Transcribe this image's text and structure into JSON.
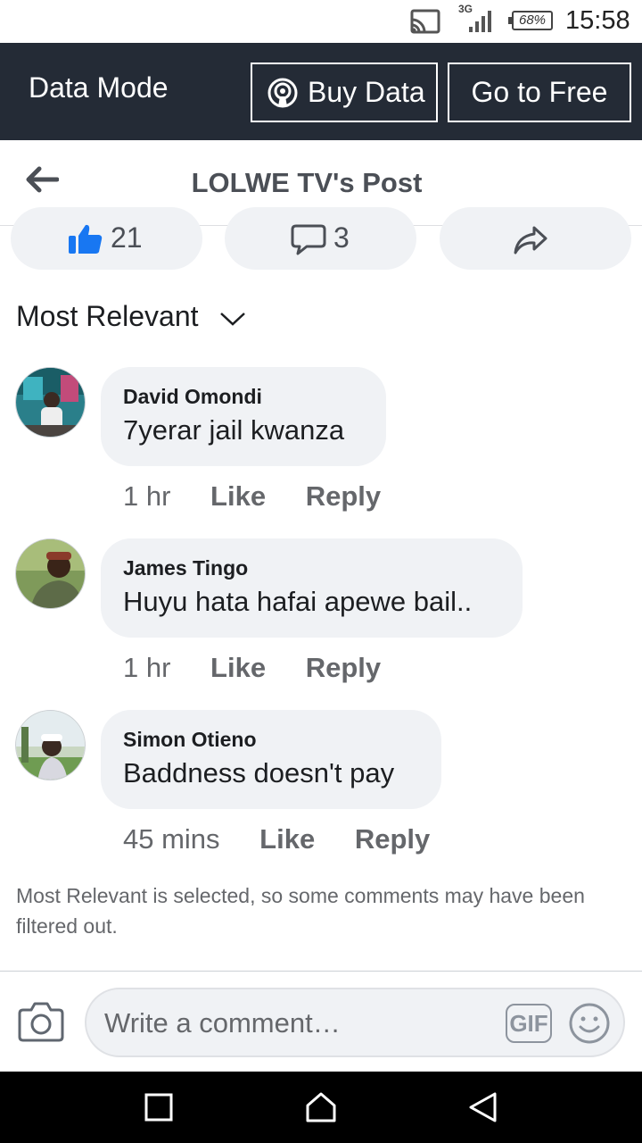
{
  "status_bar": {
    "network": "3G",
    "battery": "68%",
    "time": "15:58"
  },
  "data_mode": {
    "label": "Data Mode",
    "buy_data": "Buy Data",
    "go_free": "Go to Free"
  },
  "header": {
    "title": "LOLWE TV's Post"
  },
  "reactions": {
    "likes": "21",
    "comments": "3"
  },
  "sort": {
    "label": "Most Relevant"
  },
  "comments": [
    {
      "name": "David Omondi",
      "text": "7yerar jail kwanza",
      "time": "1 hr",
      "like": "Like",
      "reply": "Reply"
    },
    {
      "name": "James Tingo",
      "text": "Huyu hata hafai apewe bail..",
      "time": "1 hr",
      "like": "Like",
      "reply": "Reply"
    },
    {
      "name": "Simon Otieno",
      "text": "Baddness doesn't pay",
      "time": "45 mins",
      "like": "Like",
      "reply": "Reply"
    }
  ],
  "filter_note": "Most Relevant is selected, so some comments may have been filtered out.",
  "composer": {
    "placeholder": "Write a comment…",
    "gif": "GIF"
  },
  "colors": {
    "data_bar": "#242b36",
    "like_blue": "#1877f2",
    "bubble": "#f0f2f5",
    "secondary_text": "#65676b"
  },
  "icons": {
    "cast": "cast-icon",
    "signal": "signal-icon",
    "battery": "battery-icon",
    "buy_data": "broadcast-icon",
    "back": "back-arrow-icon",
    "like": "thumbs-up-icon",
    "comment": "comment-bubble-icon",
    "share": "share-arrow-icon",
    "chevron": "chevron-down-icon",
    "camera": "camera-icon",
    "gif": "gif-icon",
    "emoji": "smiley-icon",
    "nav_recents": "square-icon",
    "nav_home": "home-icon",
    "nav_back": "triangle-back-icon"
  }
}
